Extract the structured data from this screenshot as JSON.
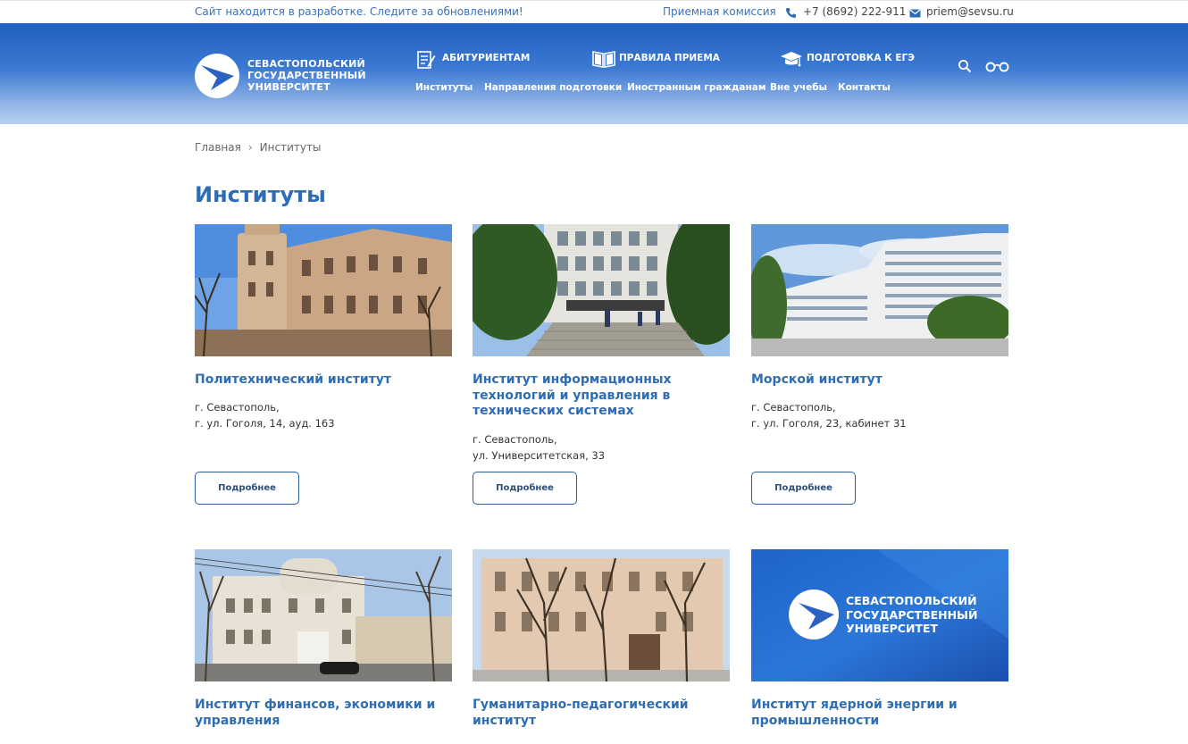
{
  "topbar": {
    "notice": "Сайт находится в разработке. Следите за обновлениями!",
    "admissions_link": "Приемная комиссия",
    "phone": "+7 (8692) 222-911",
    "email": "priem@sevsu.ru"
  },
  "header": {
    "logo_lines": [
      "СЕВАСТОПОЛЬСКИЙ",
      "ГОСУДАРСТВЕННЫЙ",
      "УНИВЕРСИТЕТ"
    ],
    "main_nav": [
      {
        "label": "АБИТУРИЕНТАМ",
        "icon": "document-pen-icon"
      },
      {
        "label": "ПРАВИЛА ПРИЕМА",
        "icon": "open-book-icon"
      },
      {
        "label": "ПОДГОТОВКА К ЕГЭ",
        "icon": "graduation-cap-icon"
      }
    ],
    "sub_nav": [
      "Институты",
      "Направления подготовки",
      "Иностранным гражданам",
      "Вне учебы",
      "Контакты"
    ],
    "icons": {
      "search": "search-icon",
      "accessibility": "glasses-icon"
    }
  },
  "breadcrumb": {
    "home": "Главная",
    "current": "Институты"
  },
  "page_title": "Институты",
  "colors": {
    "accent": "#2e6db4",
    "header_top": "#1f5fbf",
    "header_bottom": "#b7cff2"
  },
  "cards": [
    {
      "name": "Политехнический институт",
      "address_line1": "г. Севастополь,",
      "address_line2": "г. ул. Гоголя, 14, ауд. 163",
      "button": "Подробнее"
    },
    {
      "name": "Институт информационных технологий и управления в технических системах",
      "address_line1": "г. Севастополь,",
      "address_line2": "ул. Университетская, 33",
      "button": "Подробнее"
    },
    {
      "name": "Морской институт",
      "address_line1": "г. Севастополь,",
      "address_line2": "г. ул. Гоголя, 23, кабинет 31",
      "button": "Подробнее"
    },
    {
      "name": "Институт финансов, экономики и управления"
    },
    {
      "name": "Гуманитарно-педагогический институт"
    },
    {
      "name": "Институт ядерной энергии и промышленности",
      "logo_lines": [
        "СЕВАСТОПОЛЬСКИЙ",
        "ГОСУДАРСТВЕННЫЙ",
        "УНИВЕРСИТЕТ"
      ]
    }
  ]
}
